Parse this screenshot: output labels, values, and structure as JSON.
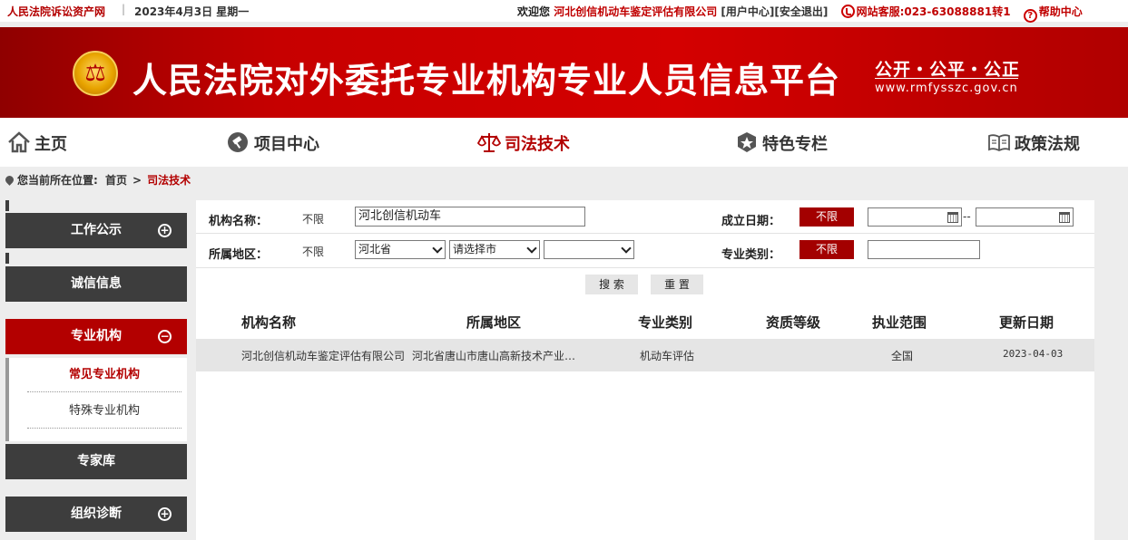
{
  "topbar": {
    "site_name": "人民法院诉讼资产网",
    "separator": "|",
    "date": "2023年4月3日  星期一",
    "welcome": "欢迎您",
    "company": "河北创信机动车鉴定评估有限公司",
    "user_center": "[用户中心]",
    "logout": "[安全退出]",
    "hotline": "网站客服:023-63088881转1",
    "help": "帮助中心"
  },
  "banner": {
    "title": "人民法院对外委托专业机构专业人员信息平台",
    "slogan": "公开・公平・公正",
    "url": "www.rmfysszc.gov.cn"
  },
  "nav": {
    "items": [
      {
        "label": "主页",
        "icon": "home-icon"
      },
      {
        "label": "项目中心",
        "icon": "gavel-icon"
      },
      {
        "label": "司法技术",
        "icon": "scales-icon"
      },
      {
        "label": "特色专栏",
        "icon": "star-badge-icon"
      },
      {
        "label": "政策法规",
        "icon": "book-icon"
      }
    ],
    "active_index": 2
  },
  "breadcrumb": {
    "prefix": "您当前所在位置:",
    "home": "首页",
    "gt": ">",
    "current": "司法技术"
  },
  "sidebar": {
    "sections": [
      {
        "label": "工作公示",
        "toggle": "+"
      },
      {
        "label": "诚信信息"
      },
      {
        "label": "专业机构",
        "toggle": "−"
      },
      {
        "label": "专家库"
      },
      {
        "label": "组织诊断",
        "toggle": "+"
      }
    ],
    "subitems": [
      "常见专业机构",
      "特殊专业机构"
    ]
  },
  "filters": {
    "org_name_label": "机构名称：",
    "unlimited": "不限",
    "org_name_value": "河北创信机动车",
    "region_label": "所属地区：",
    "province_value": "河北省",
    "city_value": "请选择市",
    "district_value": "",
    "founded_label": "成立日期：",
    "founded_from": "",
    "founded_to": "",
    "date_sep": "--",
    "category_label": "专业类别：",
    "category_value": ""
  },
  "buttons": {
    "search": "搜 索",
    "reset": "重 置"
  },
  "table": {
    "headers": [
      "机构名称",
      "所属地区",
      "专业类别",
      "资质等级",
      "执业范围",
      "更新日期"
    ],
    "rows": [
      {
        "name": "河北创信机动车鉴定评估有限公司",
        "region": "河北省唐山市唐山高新技术产业…",
        "category": "机动车评估",
        "level": "",
        "scope": "全国",
        "updated": "2023-04-03"
      }
    ]
  }
}
